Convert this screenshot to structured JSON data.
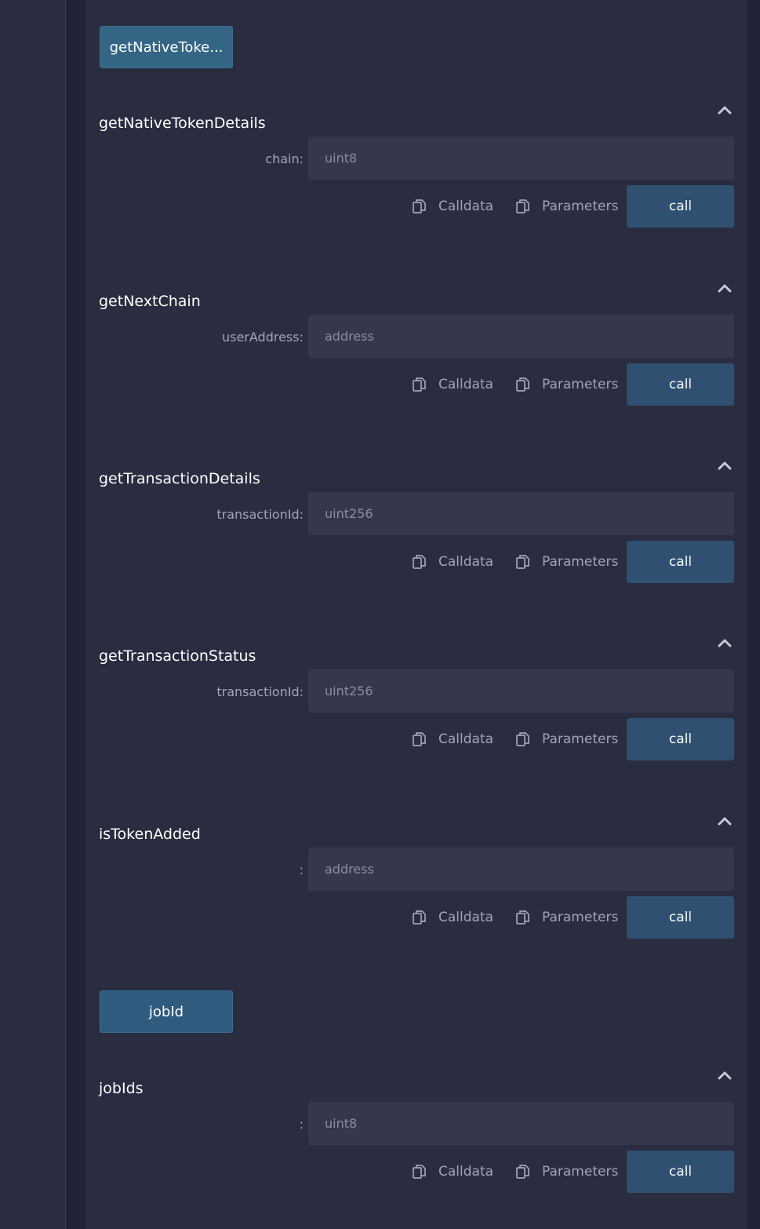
{
  "top_button": {
    "label": "getNativeToke..."
  },
  "functions": [
    {
      "name": "getNativeTokenDetails",
      "param_label": "chain:",
      "param_placeholder": "uint8",
      "calldata_label": "Calldata",
      "parameters_label": "Parameters",
      "call_label": "call"
    },
    {
      "name": "getNextChain",
      "param_label": "userAddress:",
      "param_placeholder": "address",
      "calldata_label": "Calldata",
      "parameters_label": "Parameters",
      "call_label": "call"
    },
    {
      "name": "getTransactionDetails",
      "param_label": "transactionId:",
      "param_placeholder": "uint256",
      "calldata_label": "Calldata",
      "parameters_label": "Parameters",
      "call_label": "call"
    },
    {
      "name": "getTransactionStatus",
      "param_label": "transactionId:",
      "param_placeholder": "uint256",
      "calldata_label": "Calldata",
      "parameters_label": "Parameters",
      "call_label": "call"
    },
    {
      "name": "isTokenAdded",
      "param_label": ":",
      "param_placeholder": "address",
      "calldata_label": "Calldata",
      "parameters_label": "Parameters",
      "call_label": "call"
    }
  ],
  "middle_button": {
    "label": "jobId"
  },
  "last_function": {
    "name": "jobIds",
    "param_label": ":",
    "param_placeholder": "uint8",
    "calldata_label": "Calldata",
    "parameters_label": "Parameters",
    "call_label": "call"
  },
  "icons": {
    "collapse": "chevron-up-icon",
    "copy": "copy-icon"
  },
  "colors": {
    "panel": "#2a2c3f",
    "input": "#35374c",
    "call_button": "#2f5070",
    "fn_button": "#2f5b7e"
  }
}
